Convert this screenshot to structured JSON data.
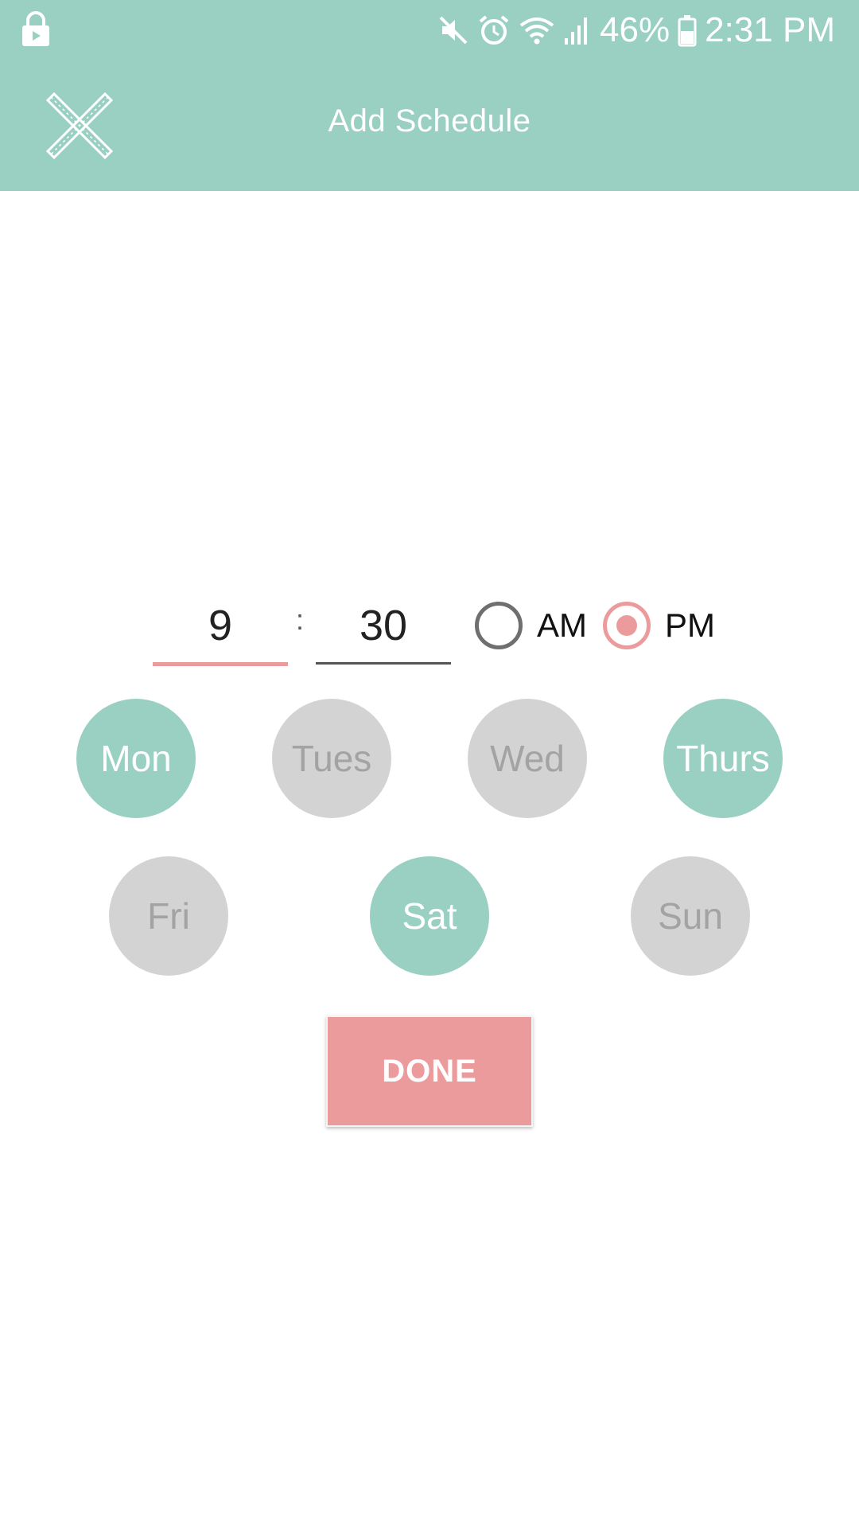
{
  "status_bar": {
    "battery_percent": "46%",
    "time": "2:31 PM",
    "icons": [
      "lock-icon",
      "mute-icon",
      "alarm-icon",
      "wifi-icon",
      "signal-icon",
      "battery-icon"
    ]
  },
  "app_bar": {
    "title": "Add Schedule",
    "close_icon": "close-icon",
    "color": "#99d0c1"
  },
  "time_picker": {
    "hour": "9",
    "separator": ":",
    "minute": "30",
    "am_label": "AM",
    "pm_label": "PM",
    "selected_period": "PM"
  },
  "days": [
    {
      "label": "Mon",
      "selected": true
    },
    {
      "label": "Tues",
      "selected": false
    },
    {
      "label": "Wed",
      "selected": false
    },
    {
      "label": "Thurs",
      "selected": true
    },
    {
      "label": "Fri",
      "selected": false
    },
    {
      "label": "Sat",
      "selected": true
    },
    {
      "label": "Sun",
      "selected": false
    }
  ],
  "done_button": {
    "label": "DONE",
    "color": "#ec9b9c"
  },
  "colors": {
    "accent": "#99d0c1",
    "highlight": "#ec9b9c",
    "inactive_day": "#d3d3d3"
  }
}
